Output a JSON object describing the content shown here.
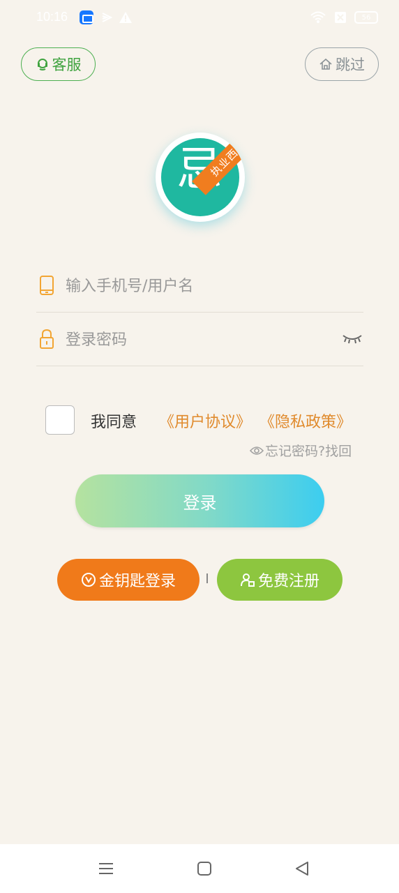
{
  "status_bar": {
    "time": "10:16",
    "battery": "56"
  },
  "header": {
    "service_label": "客服",
    "skip_label": "跳过"
  },
  "logo": {
    "ribbon_text": "执业西药",
    "glyph": "忌"
  },
  "form": {
    "username_placeholder": "输入手机号/用户名",
    "password_placeholder": "登录密码"
  },
  "agreement": {
    "agree_text": "我同意",
    "user_agreement": "《用户协议》",
    "privacy_policy": "《隐私政策》",
    "checked": false
  },
  "forgot_password": "忘记密码?找回",
  "buttons": {
    "login": "登录",
    "key_login": "金钥匙登录",
    "register": "免费注册"
  },
  "colors": {
    "background": "#f7f3ec",
    "service_green": "#4caf50",
    "orange": "#f07a1a",
    "green": "#8dc63f",
    "link_orange": "#e08a2c",
    "teal": "#1fb8a0"
  },
  "icons": {
    "service": "headset-icon",
    "skip": "home-icon",
    "phone": "phone-icon",
    "lock": "lock-icon",
    "eye": "eye-closed-icon",
    "forgot": "eye-icon",
    "key": "key-icon",
    "register": "user-add-icon"
  }
}
